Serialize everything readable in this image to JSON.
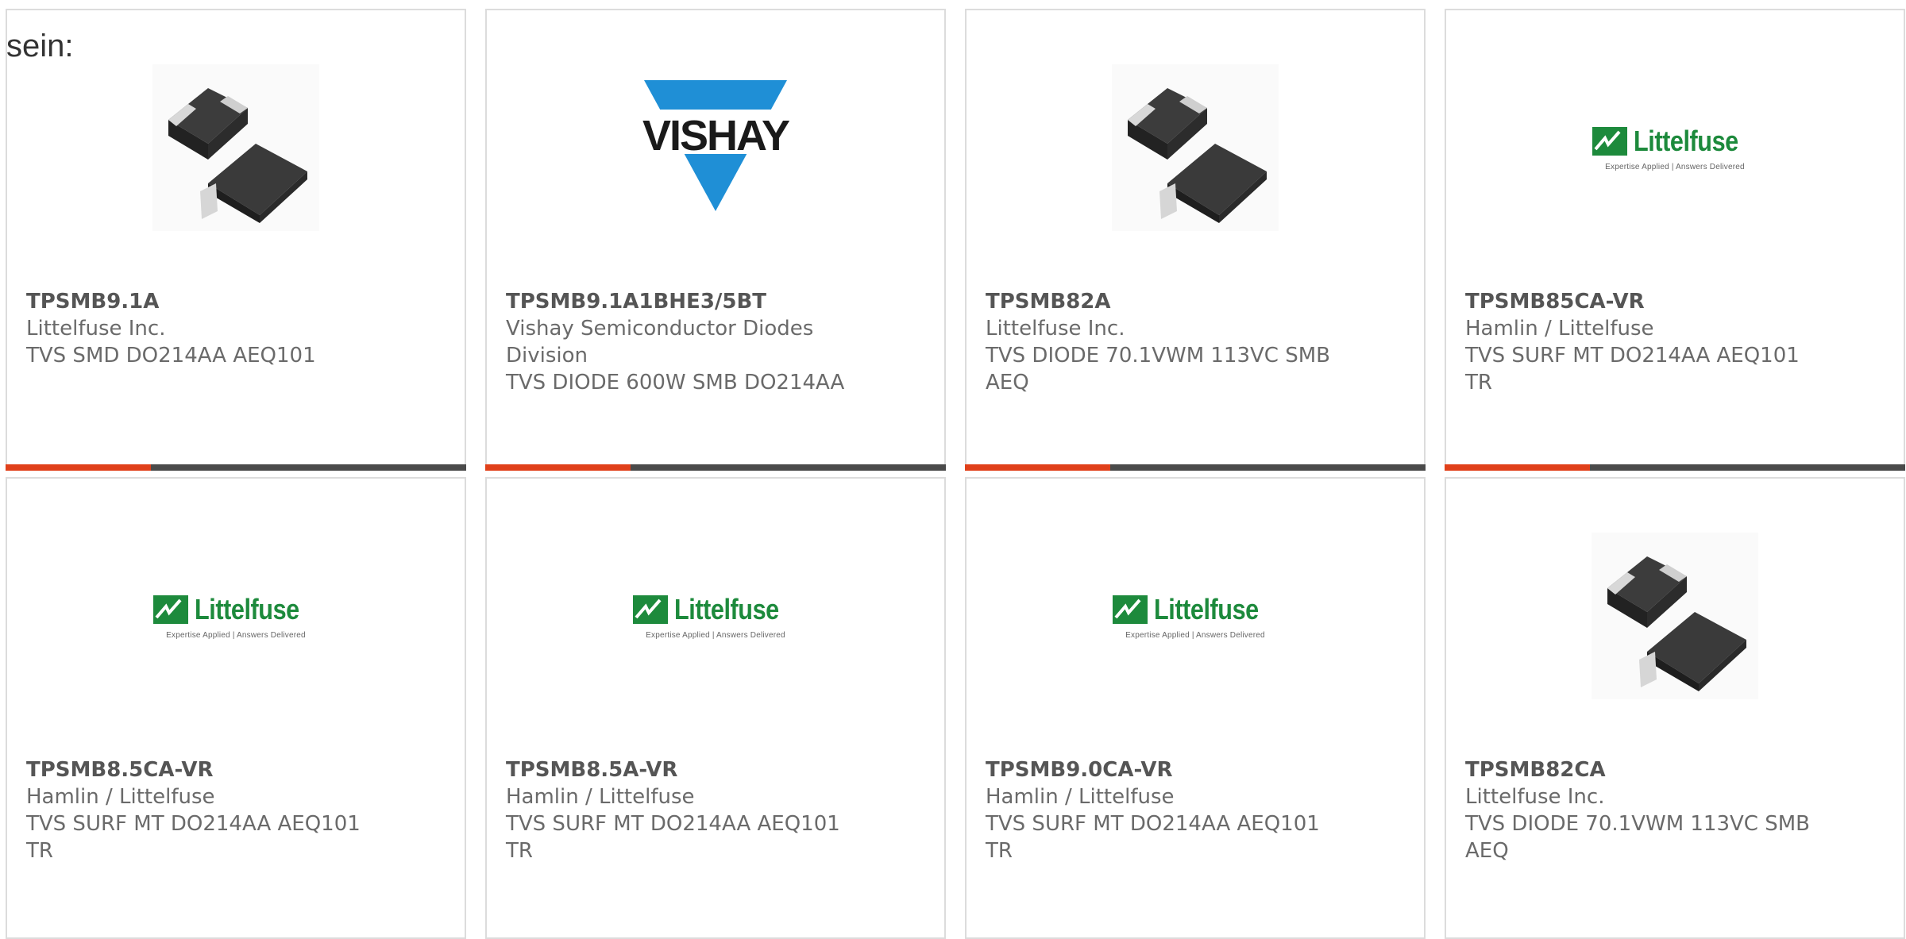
{
  "intro_text": "sein:",
  "colors": {
    "accent": "#e0401a",
    "bar": "#4a4a4a",
    "littelfuse_green": "#1d8a3c",
    "vishay_blue": "#1f8fd6"
  },
  "products": [
    {
      "part_number": "TPSMB9.1A",
      "manufacturer": "Littelfuse Inc.",
      "description": "TVS SMD DO214AA AEQ101",
      "image": "smb-diode-package"
    },
    {
      "part_number": "TPSMB9.1A1BHE3/5BT",
      "manufacturer": "Vishay Semiconductor Diodes Division",
      "description": "TVS DIODE 600W SMB DO214AA",
      "image": "vishay-logo",
      "logo_text": "VISHAY"
    },
    {
      "part_number": "TPSMB82A",
      "manufacturer": "Littelfuse Inc.",
      "description": "TVS DIODE 70.1VWM 113VC SMB AEQ",
      "image": "smb-diode-package"
    },
    {
      "part_number": "TPSMB85CA-VR",
      "manufacturer": "Hamlin / Littelfuse",
      "description": "TVS SURF MT DO214AA AEQ101 TR",
      "image": "littelfuse-logo",
      "logo_text": "Littelfuse",
      "logo_tagline": "Expertise Applied | Answers Delivered"
    },
    {
      "part_number": "TPSMB8.5CA-VR",
      "manufacturer": "Hamlin / Littelfuse",
      "description": "TVS SURF MT DO214AA AEQ101 TR",
      "image": "littelfuse-logo",
      "logo_text": "Littelfuse",
      "logo_tagline": "Expertise Applied | Answers Delivered"
    },
    {
      "part_number": "TPSMB8.5A-VR",
      "manufacturer": "Hamlin / Littelfuse",
      "description": "TVS SURF MT DO214AA AEQ101 TR",
      "image": "littelfuse-logo",
      "logo_text": "Littelfuse",
      "logo_tagline": "Expertise Applied | Answers Delivered"
    },
    {
      "part_number": "TPSMB9.0CA-VR",
      "manufacturer": "Hamlin / Littelfuse",
      "description": "TVS SURF MT DO214AA AEQ101 TR",
      "image": "littelfuse-logo",
      "logo_text": "Littelfuse",
      "logo_tagline": "Expertise Applied | Answers Delivered"
    },
    {
      "part_number": "TPSMB82CA",
      "manufacturer": "Littelfuse Inc.",
      "description": "TVS DIODE 70.1VWM 113VC SMB AEQ",
      "image": "smb-diode-package"
    }
  ]
}
